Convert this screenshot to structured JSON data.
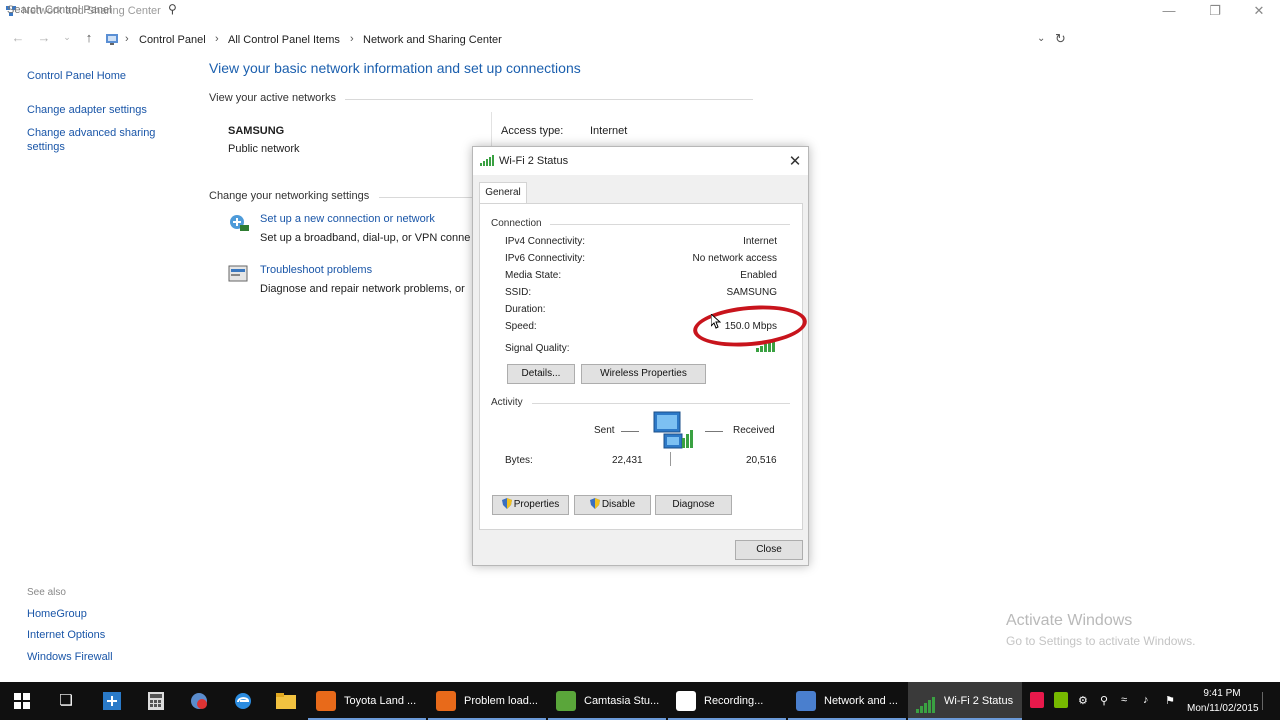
{
  "window": {
    "title": "Network and Sharing Center"
  },
  "address": {
    "crumbs": [
      "Control Panel",
      "All Control Panel Items",
      "Network and Sharing Center"
    ],
    "search_placeholder": "Search Control Panel"
  },
  "left_pane": {
    "home": "Control Panel Home",
    "links": [
      "Change adapter settings",
      "Change advanced sharing settings"
    ],
    "see_also_label": "See also",
    "see_also": [
      "HomeGroup",
      "Internet Options",
      "Windows Firewall"
    ]
  },
  "main": {
    "heading": "View your basic network information and set up connections",
    "active_networks_label": "View your active networks",
    "network_name": "SAMSUNG",
    "network_type": "Public network",
    "access_type_label": "Access type:",
    "access_type_value": "Internet",
    "change_settings_label": "Change your networking settings",
    "setup_link": "Set up a new connection or network",
    "setup_desc": "Set up a broadband, dial-up, or VPN conne",
    "troubleshoot_link": "Troubleshoot problems",
    "troubleshoot_desc": "Diagnose and repair network problems, or"
  },
  "dialog": {
    "title": "Wi-Fi 2 Status",
    "tab": "General",
    "connection_label": "Connection",
    "rows": [
      {
        "label": "IPv4 Connectivity:",
        "value": "Internet"
      },
      {
        "label": "IPv6 Connectivity:",
        "value": "No network access"
      },
      {
        "label": "Media State:",
        "value": "Enabled"
      },
      {
        "label": "SSID:",
        "value": "SAMSUNG"
      },
      {
        "label": "Duration:",
        "value": ""
      },
      {
        "label": "Speed:",
        "value": "150.0 Mbps"
      },
      {
        "label": "Signal Quality:",
        "value": ""
      }
    ],
    "details_button": "Details...",
    "wireless_button": "Wireless Properties",
    "activity_label": "Activity",
    "sent_label": "Sent",
    "received_label": "Received",
    "bytes_label": "Bytes:",
    "bytes_sent": "22,431",
    "bytes_received": "20,516",
    "properties_button": "Properties",
    "disable_button": "Disable",
    "diagnose_button": "Diagnose",
    "close_button": "Close"
  },
  "watermark": {
    "line1": "Activate Windows",
    "line2": "Go to Settings to activate Windows."
  },
  "taskbar": {
    "apps": [
      {
        "label": "Toyota Land ...",
        "icon": "firefox-icon"
      },
      {
        "label": "Problem load...",
        "icon": "firefox-icon"
      },
      {
        "label": "Camtasia Stu...",
        "icon": "camtasia-icon"
      },
      {
        "label": "Recording...",
        "icon": "camtasia-recorder-icon"
      },
      {
        "label": "Network and ...",
        "icon": "network-icon"
      },
      {
        "label": "Wi-Fi 2 Status",
        "icon": "wifi-icon"
      }
    ],
    "clock_time": "9:41 PM",
    "clock_date": "Mon/11/02/2015"
  },
  "colors": {
    "link": "#1a56a8",
    "heading": "#1b5fae",
    "highlight": "#c8141c",
    "taskbar": "#101010"
  }
}
